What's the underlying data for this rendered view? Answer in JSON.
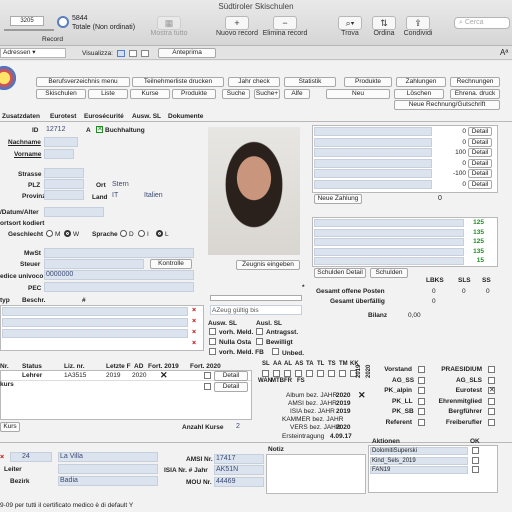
{
  "window": {
    "title": "Südtiroler Skischulen"
  },
  "toolbar": {
    "record_number": "3205",
    "records_total": "5844",
    "records_status": "Totale (Non ordinati)",
    "record_label": "Record",
    "show_all": "Mostra tutto",
    "new_record": "Nuovo record",
    "delete_record": "Elimina record",
    "find": "Trova",
    "sort": "Ordina",
    "share": "Condividi",
    "search_placeholder": "Cerca"
  },
  "statusbar": {
    "layout": "Adressen",
    "view_label": "Visualizza:",
    "preview": "Anteprima"
  },
  "nav": {
    "row1": [
      "Berufsverzeichnis menu",
      "Teilnehmerliste drucken",
      "Jahr check",
      "Statistik",
      "Produkte",
      "Zahlungen",
      "Rechnungen"
    ],
    "row2": [
      "Skischulen",
      "Liste",
      "Kurse",
      "Produkte",
      "Suche",
      "Suche+",
      "Alfe",
      "Neu",
      "Löschen",
      "Ehrena. druck"
    ],
    "new_invoice": "Neue Rechnung/Gutschrift"
  },
  "tabs": [
    "Zusatzdaten",
    "Eurotest",
    "Eurosécurité",
    "Ausw. SL",
    "Dokumente"
  ],
  "person": {
    "id_label": "ID",
    "id": "12712",
    "a_label": "A",
    "accounting": "Buchhaltung",
    "lastname_label": "Nachname",
    "firstname_label": "Vorname",
    "street_label": "Strasse",
    "zip_label": "PLZ",
    "city_label": "Ort",
    "city": "Stern",
    "province_label": "Provinz",
    "country_label": "Land",
    "country": "IT",
    "country_name": "Italien",
    "birth_label": "/Datum/Alter",
    "birthplace_label": "ortsort kodiert",
    "gender_label": "Geschlecht",
    "gender_m": "M",
    "gender_w": "W",
    "lang_label": "Sprache",
    "lang_d": "D",
    "lang_i": "I",
    "lang_l": "L",
    "vat_label": "MwSt",
    "tax_label": "Steuer",
    "control_btn": "Kontrolle",
    "code_label": "edice univoco",
    "code": "0000000",
    "pec_label": "PEC",
    "type_label": "typ",
    "desc_label": "Beschr.",
    "hash_label": "#"
  },
  "photo": {
    "certify_btn": "Zeugnis eingeben"
  },
  "payments": {
    "rows": [
      {
        "value": "0",
        "btn": "Detail"
      },
      {
        "value": "0",
        "btn": "Detail"
      },
      {
        "value": "100",
        "btn": "Detail"
      },
      {
        "value": "0",
        "btn": "Detail"
      },
      {
        "value": "-100",
        "btn": "Detail"
      },
      {
        "value": "0",
        "btn": "Detail"
      }
    ],
    "new_payment": "Neue Zahlung",
    "new_payment_value": "0"
  },
  "debts": {
    "rows": [
      {
        "value": "125"
      },
      {
        "value": "135"
      },
      {
        "value": "125"
      },
      {
        "value": "135"
      },
      {
        "value": "15"
      }
    ],
    "debt_detail": "Schulden Detail",
    "debt": "Schulden",
    "col_lbks": "LBKS",
    "col_sls": "SLS",
    "col_ss": "SS",
    "open_label": "Gesamt offene Posten",
    "open_vals": [
      "0",
      "0",
      "0"
    ],
    "over_label": "Gesamt überfällig",
    "over_vals": [
      "0"
    ],
    "balance_label": "Bilanz",
    "balance": "0,00"
  },
  "validity": {
    "label": "AZeug gültig bis",
    "ausw_sl": "Ausw. SL",
    "ausl_sl": "Ausl. SL",
    "vorh_meld": "vorh. Meld.",
    "nulla_osta": "Nulla Osta",
    "vorh_meld_fb": "vorh. Meld. FB",
    "antragsst": "Antragsst.",
    "bewilligt": "Bewilligt",
    "unbed": "Unbed."
  },
  "courses": {
    "head": [
      "Nr.",
      "Status",
      "Liz. nr.",
      "Letzte F",
      "AD",
      "Fort. 2019",
      "Fort. 2020"
    ],
    "row": {
      "status": "Lehrer",
      "liz": "1A3515",
      "letzte": "2019",
      "ad": "2020",
      "detail1": "Detail",
      "detail2": "Detail"
    },
    "course_label": "kurs",
    "course_btn": "Kurs",
    "count_label": "Anzahl Kurse",
    "count": "2"
  },
  "sl": {
    "head": [
      "SL",
      "AA",
      "AL",
      "AS",
      "TA",
      "TL",
      "TS",
      "TM",
      "KK"
    ],
    "sub": [
      "WAN",
      "MTB",
      "FR",
      "FS"
    ],
    "album_label": "Album bez. JAHR",
    "album": "2020",
    "amsi_label": "AMSI bez. JAHR",
    "amsi": "2019",
    "isia_label": "ISIA bez. JAHR",
    "isia": "2019",
    "kammer_label": "KAMMER bez. JAHR",
    "vers_label": "VERS bez. JAHR",
    "vers": "2020",
    "entry_label": "Ersteintragung",
    "entry": "4.09.17",
    "year1": "2019",
    "year2": "2020"
  },
  "flags": {
    "vorstand": "Vorstand",
    "ag_ss": "AG_SS",
    "pk_alpin": "PK_alpin",
    "pk_ll": "PK_LL",
    "pk_sb": "PK_SB",
    "referent": "Referent",
    "praesidium": "PRAESIDIUM",
    "ag_sls": "AG_SLS",
    "eurotest": "Eurotest",
    "ehrenmitglied": "Ehrenmitglied",
    "bergfuehrer": "Bergführer",
    "freiberufler": "Freiberufler"
  },
  "school": {
    "num": "24",
    "name": "La Villa",
    "leader_label": "Leiter",
    "district_label": "Bezirk",
    "district": "Badia",
    "amsi_label": "AMSI Nr.",
    "amsi": "17417",
    "isia_label": "ISIA Nr. # Jahr",
    "isia": "AK51N",
    "mou_label": "MOU Nr.",
    "mou": "44469",
    "notes_label": "Notiz"
  },
  "actions": {
    "label": "Aktionen",
    "ok_label": "OK",
    "items": [
      "DolomitiSuperski",
      "Kind_Sels_2019",
      "FAN19"
    ]
  },
  "footer": {
    "text": "9-09 per tutti il certificato medico è di default Y"
  },
  "colors": {
    "accent": "#3b4a73",
    "field": "#dbe3ef",
    "green": "#1e8c1e",
    "red": "#cc0000"
  }
}
